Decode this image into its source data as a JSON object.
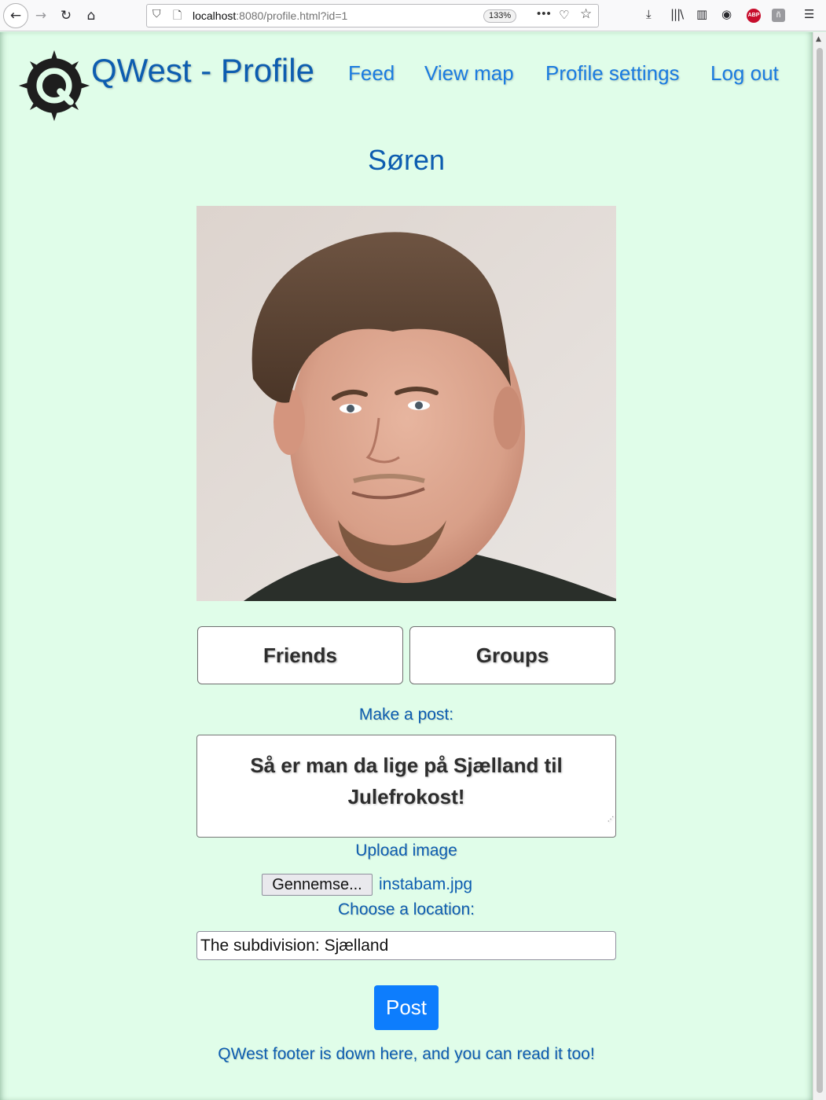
{
  "browser": {
    "url_host": "localhost",
    "url_path": ":8080/profile.html?id=1",
    "zoom": "133%",
    "abp_label": "ABP",
    "ext_label": "ñ"
  },
  "header": {
    "title": "QWest - Profile",
    "nav": {
      "feed": "Feed",
      "view_map": "View map",
      "profile_settings": "Profile settings",
      "log_out": "Log out"
    }
  },
  "profile": {
    "name": "Søren",
    "friends_label": "Friends",
    "groups_label": "Groups"
  },
  "post_form": {
    "make_post_label": "Make a post:",
    "text": "Så er man da lige på Sjælland til Julefrokost!",
    "upload_label": "Upload image",
    "browse_label": "Gennemse...",
    "file_name": "instabam.jpg",
    "location_label": "Choose a location:",
    "location_value": "The subdivision: Sjælland",
    "post_label": "Post"
  },
  "footer": {
    "text": "QWest footer is down here, and you can read it too!"
  },
  "colors": {
    "page_background": "#e0fde9",
    "title_blue": "#0d5db0",
    "link_blue": "#1a7be0",
    "post_button": "#0d7dfd"
  },
  "icons": [
    "back-icon",
    "forward-icon",
    "reload-icon",
    "home-icon",
    "shield-icon",
    "page-icon",
    "more-icon",
    "pocket-icon",
    "star-icon",
    "download-icon",
    "library-icon",
    "sidebar-icon",
    "account-icon",
    "adblock-icon",
    "extension-icon",
    "menu-icon",
    "compass-logo-icon"
  ]
}
